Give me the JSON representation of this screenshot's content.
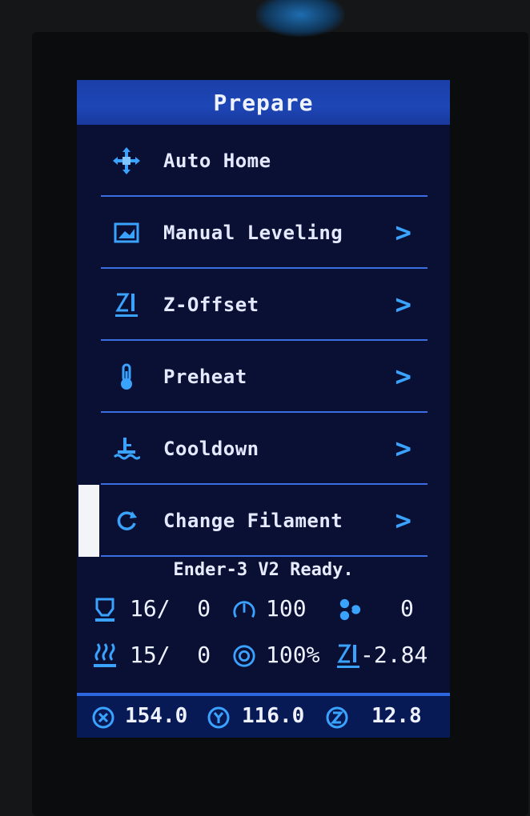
{
  "header": {
    "title": "Prepare"
  },
  "menu": {
    "items": [
      {
        "label": "Auto Home",
        "icon": "home-axes-icon",
        "has_submenu": false
      },
      {
        "label": "Manual Leveling",
        "icon": "bed-leveling-icon",
        "has_submenu": true
      },
      {
        "label": "Z-Offset",
        "icon": "z-offset-icon",
        "has_submenu": true
      },
      {
        "label": "Preheat",
        "icon": "thermometer-icon",
        "has_submenu": true
      },
      {
        "label": "Cooldown",
        "icon": "cooldown-icon",
        "has_submenu": true
      },
      {
        "label": "Change Filament",
        "icon": "refresh-icon",
        "has_submenu": true,
        "selected": true
      }
    ],
    "chevron": ">"
  },
  "status": {
    "message": "Ender-3 V2 Ready.",
    "hotend": "16/  0",
    "speed": "100",
    "fan": "0",
    "bed": "15/  0",
    "flow": "100%",
    "z_offset": "-2.84"
  },
  "position": {
    "x": "154.0",
    "y": "116.0",
    "z": "12.8"
  },
  "colors": {
    "accent": "#3aa3ff",
    "title_bar": "#1d46b6",
    "background": "#0a1033",
    "divider": "#3a6ee0"
  }
}
